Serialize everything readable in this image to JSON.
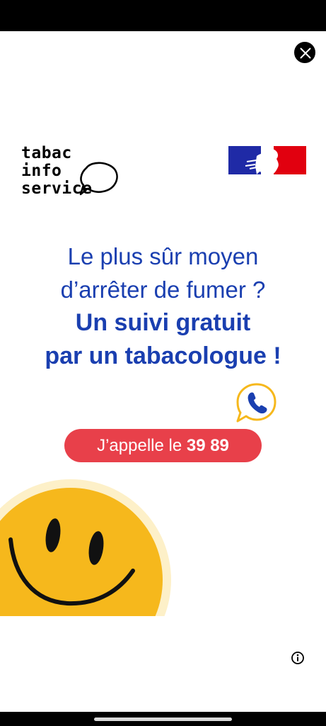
{
  "ad": {
    "logo": {
      "lines": [
        "tabac",
        "info",
        "service"
      ]
    },
    "headline": {
      "line1": "Le plus sûr moyen",
      "line2": "d’arrêter de fumer ?",
      "line3": "Un suivi gratuit",
      "line4": "par un tabacologue !"
    },
    "cta": {
      "prefix": "J’appelle le ",
      "number": "39 89"
    },
    "colors": {
      "headline_blue": "#1a3fb0",
      "cta_red": "#e8404a",
      "smiley_yellow": "#f6b81c",
      "flag_blue": "#1f2aa6",
      "flag_red": "#e1000f"
    },
    "icons": {
      "close": "close-icon",
      "phone": "phone-bubble-icon",
      "info": "info-icon",
      "smiley": "smiley-icon",
      "flag": "marianne-flag-icon"
    }
  }
}
